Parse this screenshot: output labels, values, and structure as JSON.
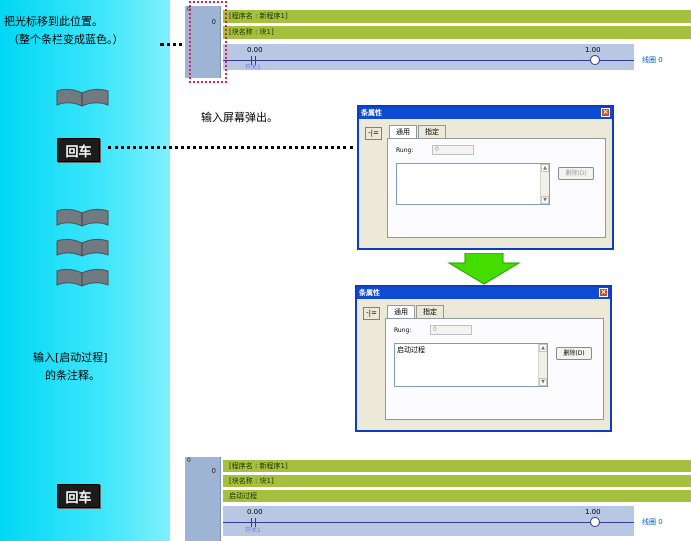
{
  "instructions": {
    "step1_line1": "把光标移到此位置。",
    "step1_line2": "（整个条栏变成蓝色。）",
    "enter_key_1": "回车",
    "popup_note": "输入屏幕弹出。",
    "step2_line1": "输入[启动过程]",
    "step2_line2": "的条注释。",
    "enter_key_2": "回车"
  },
  "ladder_top": {
    "program_name": "[程序名 : 新程序1]",
    "block_name": "[块名称 : 块1]",
    "gutter_number": "0",
    "gutter_zero": "0",
    "tick_start": "0.00",
    "tick_end": "1.00",
    "contact_label": "开关1",
    "continue_label": "线圈 0"
  },
  "ladder_bottom": {
    "program_name": "[程序名 : 新程序1]",
    "block_name": "[块名称 : 块1]",
    "rung_comment": "启动过程",
    "gutter_number": "0",
    "gutter_zero": "0",
    "tick_start": "0.00",
    "tick_end": "1.00",
    "contact_label": "开关1",
    "continue_label": "线圈 0"
  },
  "dialog_before": {
    "title": "条属性",
    "close": "×",
    "pin": "-|=",
    "tab_general": "通用",
    "tab_annotation": "指定",
    "rung_label": "Rung:",
    "rung_value": "0",
    "comment": "",
    "delete_button": "删除(D)"
  },
  "dialog_after": {
    "title": "条属性",
    "close": "×",
    "pin": "-|=",
    "tab_general": "通用",
    "tab_annotation": "指定",
    "rung_label": "Rung:",
    "rung_value": "0",
    "comment": "启动过程",
    "delete_button": "删除(D)"
  },
  "colors": {
    "left_panel": "#00d8f5",
    "rung_bar": "#a5c03e",
    "gutter": "#9eb4d4",
    "dialog_title": "#0f4bd2",
    "arrow": "#44dd00"
  }
}
